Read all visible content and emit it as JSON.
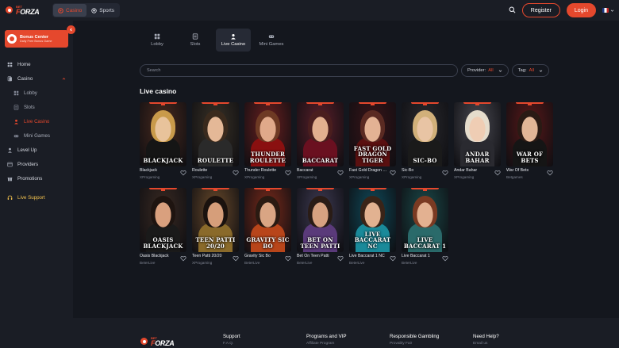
{
  "brand": {
    "small": "BET",
    "name_a": "F",
    "name_b": "ORZA"
  },
  "header": {
    "modes": [
      {
        "label": "Casino"
      },
      {
        "label": "Sports"
      }
    ],
    "register_label": "Register",
    "login_label": "Login"
  },
  "sidebar": {
    "bonus_title": "Bonus Center",
    "bonus_sub": "Daily Free Bonus Game",
    "items": [
      {
        "label": "Home"
      },
      {
        "label": "Casino"
      },
      {
        "label": "Lobby"
      },
      {
        "label": "Slots"
      },
      {
        "label": "Live Casino"
      },
      {
        "label": "Mini Games"
      },
      {
        "label": "Level Up"
      },
      {
        "label": "Providers"
      },
      {
        "label": "Promotions"
      },
      {
        "label": "Live Support"
      }
    ]
  },
  "tabs": [
    {
      "label": "Lobby"
    },
    {
      "label": "Slots"
    },
    {
      "label": "Live Casino"
    },
    {
      "label": "Mini Games"
    }
  ],
  "search": {
    "placeholder": "Search"
  },
  "filters": {
    "provider_label": "Provider:",
    "provider_value": "All",
    "tag_label": "Tag:",
    "tag_value": "All"
  },
  "section_title": "Live casino",
  "games": [
    {
      "title": "Blackjack",
      "art": "Blackjack",
      "provider": "XProgaming",
      "skin": "#e8c39b",
      "hair": "#c99a4a",
      "bg": "#4a2a1e",
      "dress": "#151515"
    },
    {
      "title": "Roulette",
      "art": "Roulette",
      "provider": "XProgaming",
      "skin": "#e4b897",
      "hair": "#3a2a1d",
      "bg": "#3a3226",
      "dress": "#2a2a2a"
    },
    {
      "title": "Thunder Roulette",
      "art": "Thunder Roulette",
      "provider": "XProgaming",
      "skin": "#e0a98a",
      "hair": "#6e3a24",
      "bg": "#6b1f1f",
      "dress": "#8a1010"
    },
    {
      "title": "Baccarat",
      "art": "Baccarat",
      "provider": "XProgaming",
      "skin": "#e2b08f",
      "hair": "#4a1e1e",
      "bg": "#5c1f2a",
      "dress": "#6a1020"
    },
    {
      "title": "Fast Gold Dragon Tiger",
      "art": "Fast Gold Dragon Tiger",
      "provider": "XProgaming",
      "skin": "#e3b294",
      "hair": "#5a2a22",
      "bg": "#3a1418",
      "dress": "#5a1010"
    },
    {
      "title": "Sic-Bo",
      "art": "Sic-Bo",
      "provider": "XProgaming",
      "skin": "#e8c4a4",
      "hair": "#d1b07a",
      "bg": "#2a2a2e",
      "dress": "#1a1a1a"
    },
    {
      "title": "Andar Bahar",
      "art": "Andar Bahar",
      "provider": "XProgaming",
      "skin": "#efcdb4",
      "hair": "#e5dccc",
      "bg": "#4a4a52",
      "dress": "#2a2a30"
    },
    {
      "title": "War Of Bets",
      "art": "War Of Bets",
      "provider": "Betgames",
      "skin": "#e2b697",
      "hair": "#2a1a14",
      "bg": "#5a1818",
      "dress": "#151515"
    },
    {
      "title": "Oasis Blackjack",
      "art": "Oasis Blackjack",
      "provider": "BeterLive",
      "skin": "#d9a07e",
      "hair": "#1e1410",
      "bg": "#3a2a22",
      "dress": "#1a1a1a"
    },
    {
      "title": "Teen Patti 20/20",
      "art": "Teen Patti 20/20",
      "provider": "XProgaming",
      "skin": "#d69e7a",
      "hair": "#1a120e",
      "bg": "#6a4a2a",
      "dress": "#8a6a2a"
    },
    {
      "title": "Gravity Sic Bo",
      "art": "Gravity Sic Bo",
      "provider": "BeterLive",
      "skin": "#d9a584",
      "hair": "#2a1a12",
      "bg": "#7a2a1a",
      "dress": "#b8451a"
    },
    {
      "title": "Bet On Teen Patti",
      "art": "Bet On Teen Patti",
      "provider": "BeterLive",
      "skin": "#d7a281",
      "hair": "#2a1c16",
      "bg": "#3e3a52",
      "dress": "#5a3a7a"
    },
    {
      "title": "Live Baccarat 1 NC",
      "art": "Live Baccarat NC",
      "provider": "BeterLive",
      "skin": "#e2b291",
      "hair": "#3a2418",
      "bg": "#0f4a5a",
      "dress": "#1a8a9a"
    },
    {
      "title": "Live Baccarat 1",
      "art": "Live Baccarat 1",
      "provider": "BeterLive",
      "skin": "#e3b191",
      "hair": "#7a3a22",
      "bg": "#1a4a4a",
      "dress": "#2a6a6a"
    }
  ],
  "footer": {
    "cols": [
      {
        "title": "Support",
        "sub": "F.A.Q."
      },
      {
        "title": "Programs and VIP",
        "sub": "Affiliate Program"
      },
      {
        "title": "Responsible Gambling",
        "sub": "Provably Fair"
      },
      {
        "title": "Need Help?",
        "sub": "Email us"
      }
    ]
  }
}
